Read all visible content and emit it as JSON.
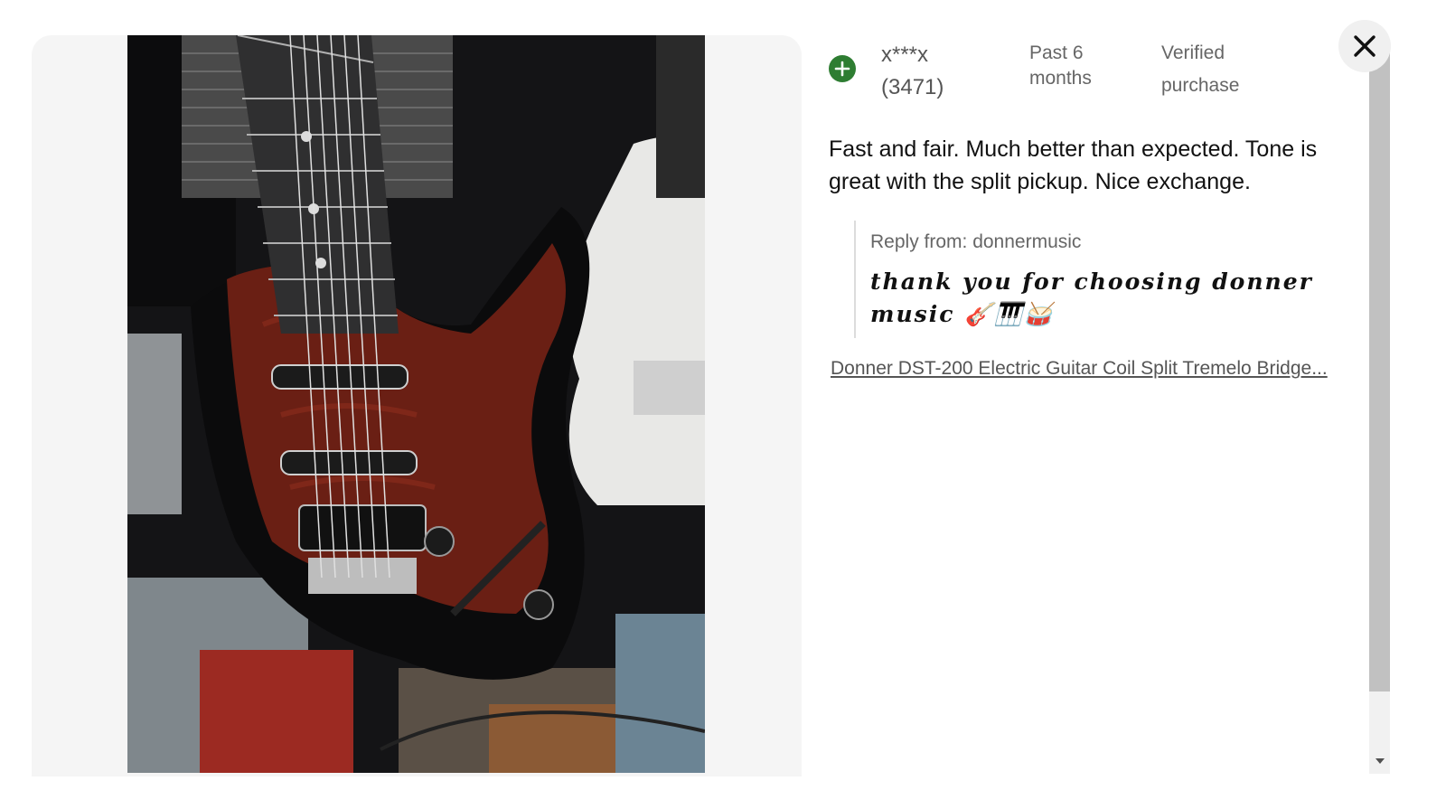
{
  "review": {
    "reviewer_name": "x***x",
    "reviewer_count": "(3471)",
    "timeframe": "Past 6 months",
    "verified_label": "Verified purchase",
    "text": "Fast and fair. Much better than expected. Tone is great with the split pickup. Nice exchange.",
    "reply_label": "Reply from: donnermusic",
    "reply_message": "thank you for choosing donner music 🎸🎹🥁",
    "product_link": "Donner DST-200 Electric Guitar Coil Split Tremelo Bridge..."
  },
  "icons": {
    "add": "plus-circle-icon",
    "close": "close-icon",
    "scroll_down": "chevron-down-icon"
  },
  "colors": {
    "add_icon": "#2e7d32",
    "panel_background": "#f5f5f5",
    "pickguard": "#6a1f14",
    "guitar_body": "#0b0b0c"
  }
}
